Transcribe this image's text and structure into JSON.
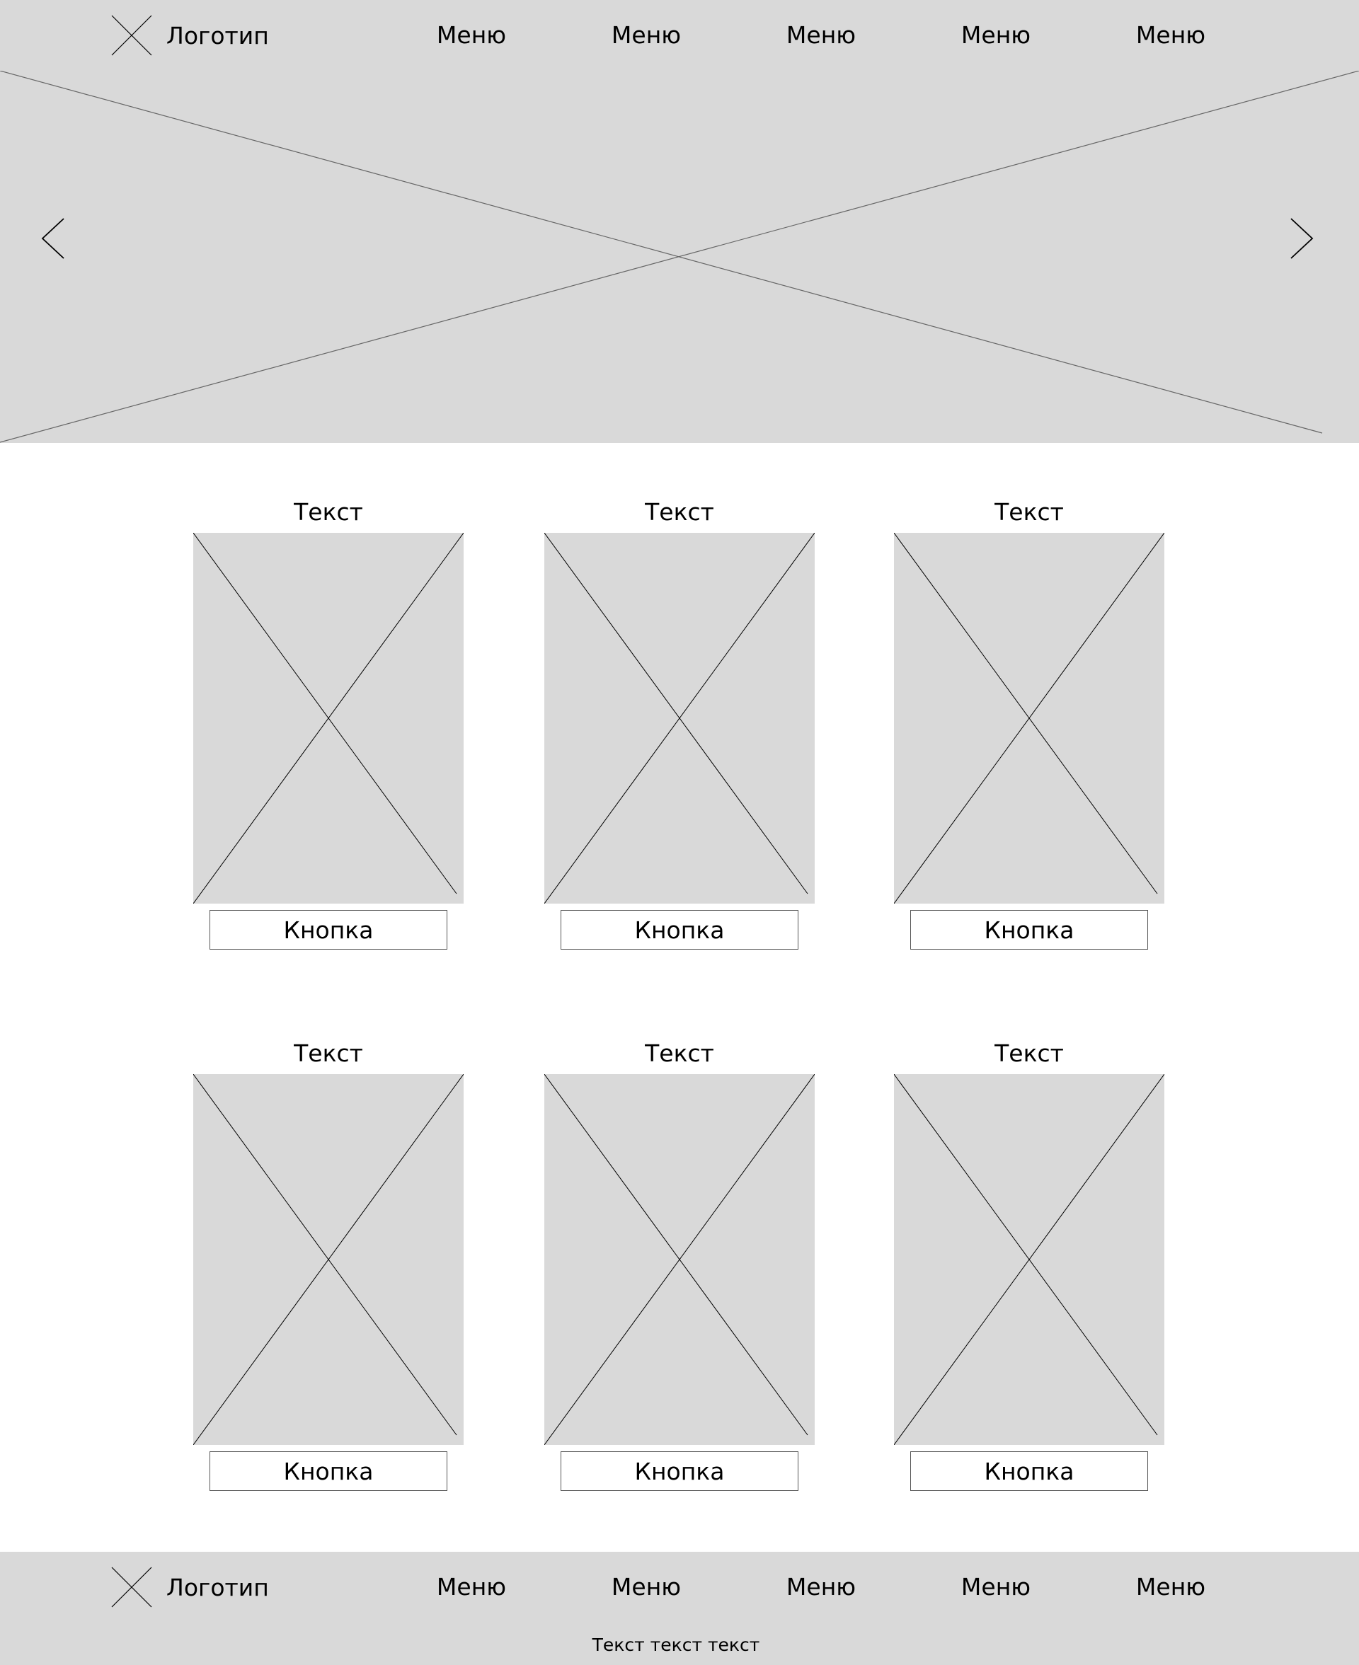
{
  "header": {
    "logo_icon": "placeholder-x-icon",
    "logo_text": "Логотип",
    "menu": [
      "Меню",
      "Меню",
      "Меню",
      "Меню",
      "Меню"
    ]
  },
  "hero": {
    "image": "placeholder-image",
    "prev_icon": "chevron-left-icon",
    "next_icon": "chevron-right-icon"
  },
  "cards": [
    {
      "title": "Текст",
      "button": "Кнопка"
    },
    {
      "title": "Текст",
      "button": "Кнопка"
    },
    {
      "title": "Текст",
      "button": "Кнопка"
    },
    {
      "title": "Текст",
      "button": "Кнопка"
    },
    {
      "title": "Текст",
      "button": "Кнопка"
    },
    {
      "title": "Текст",
      "button": "Кнопка"
    }
  ],
  "footer": {
    "logo_icon": "placeholder-x-icon",
    "logo_text": "Логотип",
    "menu": [
      "Меню",
      "Меню",
      "Меню",
      "Меню",
      "Меню"
    ],
    "text": "Текст текст текст"
  },
  "colors": {
    "placeholder_fill": "#d9d9d9",
    "background": "#ffffff",
    "line": "#000000",
    "button_border": "#555555"
  }
}
